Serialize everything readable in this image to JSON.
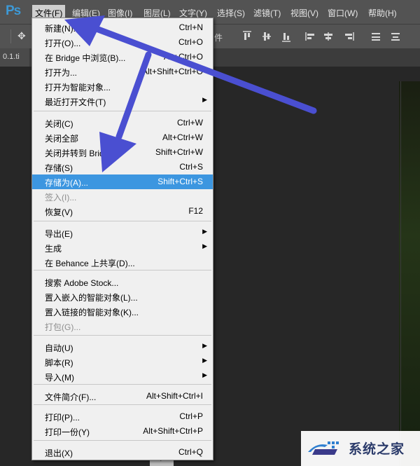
{
  "app": {
    "logo": "Ps"
  },
  "menubar": {
    "items": [
      "文件(F)",
      "编辑(E)",
      "图像(I)",
      "图层(L)",
      "文字(Y)",
      "选择(S)",
      "滤镜(T)",
      "视图(V)",
      "窗口(W)",
      "帮助(H)"
    ],
    "active_index": 0
  },
  "options_bar": {
    "label": "件",
    "icons": [
      "move-tool-icon",
      "align-top-icon",
      "align-vcenter-icon",
      "align-bottom-icon",
      "align-left-icon",
      "align-hcenter-icon",
      "align-right-icon"
    ]
  },
  "document_tab": {
    "label": "0.1.ti"
  },
  "file_menu": {
    "items": [
      {
        "label": "新建(N)...",
        "shortcut": "Ctrl+N"
      },
      {
        "label": "打开(O)...",
        "shortcut": "Ctrl+O"
      },
      {
        "label": "在 Bridge 中浏览(B)...",
        "shortcut": "Alt+Ctrl+O"
      },
      {
        "label": "打开为...",
        "shortcut": "Alt+Shift+Ctrl+O"
      },
      {
        "label": "打开为智能对象...",
        "shortcut": ""
      },
      {
        "label": "最近打开文件(T)",
        "shortcut": "",
        "submenu": true
      },
      {
        "label": "关闭(C)",
        "shortcut": "Ctrl+W"
      },
      {
        "label": "关闭全部",
        "shortcut": "Alt+Ctrl+W"
      },
      {
        "label": "关闭并转到 Bridge...",
        "shortcut": "Shift+Ctrl+W"
      },
      {
        "label": "存储(S)",
        "shortcut": "Ctrl+S"
      },
      {
        "label": "存储为(A)...",
        "shortcut": "Shift+Ctrl+S",
        "highlighted": true
      },
      {
        "label": "签入(I)...",
        "shortcut": "",
        "disabled": true
      },
      {
        "label": "恢复(V)",
        "shortcut": "F12"
      },
      {
        "label": "导出(E)",
        "shortcut": "",
        "submenu": true
      },
      {
        "label": "生成",
        "shortcut": "",
        "submenu": true
      },
      {
        "label": "在 Behance 上共享(D)...",
        "shortcut": ""
      },
      {
        "label": "搜索 Adobe Stock...",
        "shortcut": ""
      },
      {
        "label": "置入嵌入的智能对象(L)...",
        "shortcut": ""
      },
      {
        "label": "置入链接的智能对象(K)...",
        "shortcut": ""
      },
      {
        "label": "打包(G)...",
        "shortcut": "",
        "disabled": true
      },
      {
        "label": "自动(U)",
        "shortcut": "",
        "submenu": true
      },
      {
        "label": "脚本(R)",
        "shortcut": "",
        "submenu": true
      },
      {
        "label": "导入(M)",
        "shortcut": "",
        "submenu": true
      },
      {
        "label": "文件简介(F)...",
        "shortcut": "Alt+Shift+Ctrl+I"
      },
      {
        "label": "打印(P)...",
        "shortcut": "Ctrl+P"
      },
      {
        "label": "打印一份(Y)",
        "shortcut": "Alt+Shift+Ctrl+P"
      },
      {
        "label": "退出(X)",
        "shortcut": "Ctrl+Q"
      }
    ]
  },
  "watermark": {
    "text": "系统之家"
  },
  "colors": {
    "menubar": "#535353",
    "menu_bg": "#f0f0f0",
    "highlight": "#3c96e0",
    "annotation_arrow": "#4a4fd1",
    "logo": "#3d99d6"
  }
}
